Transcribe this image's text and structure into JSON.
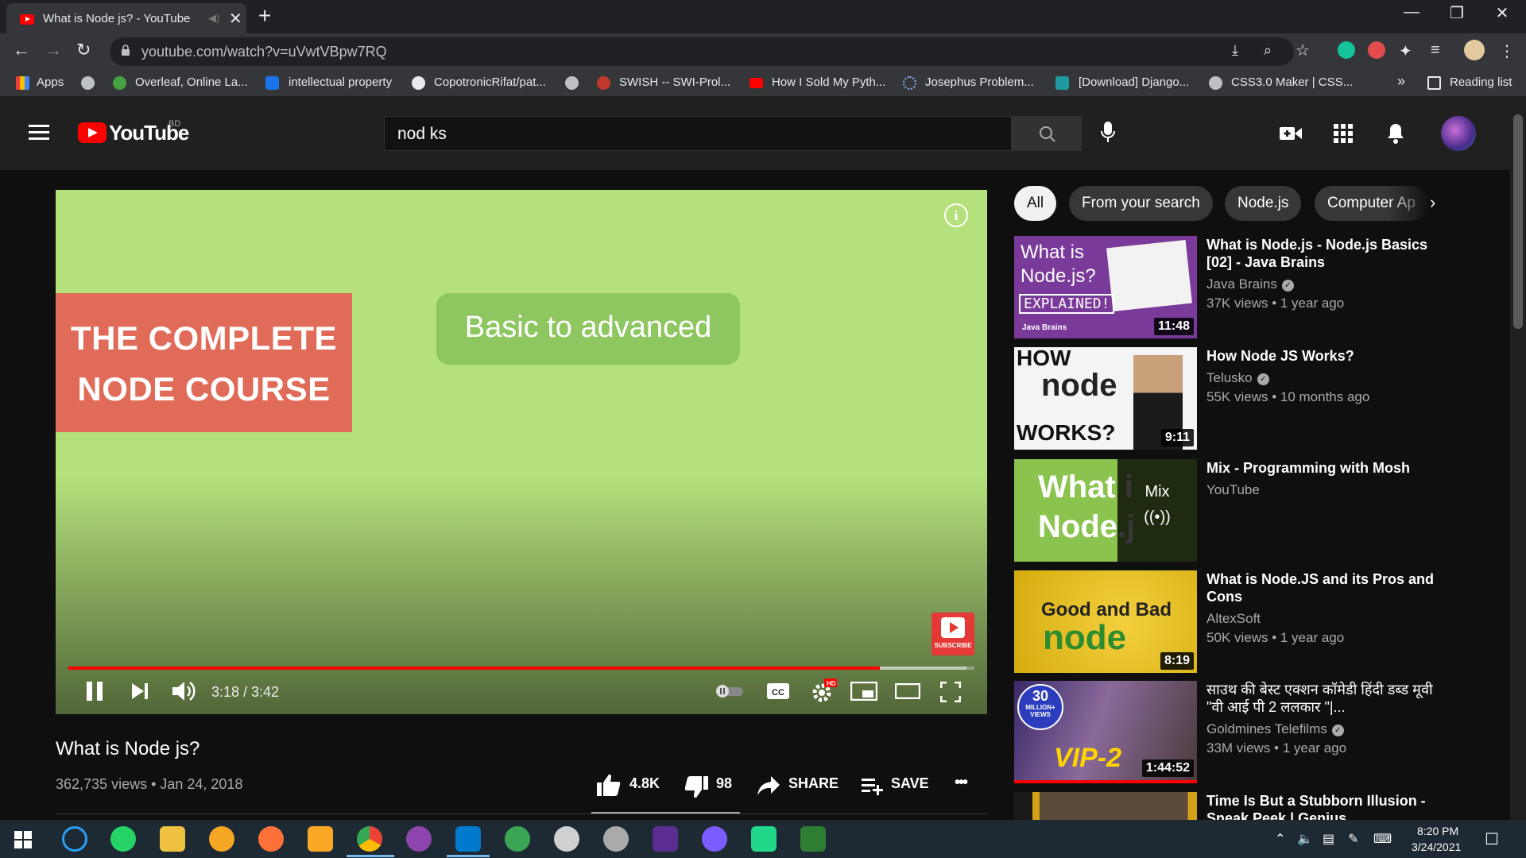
{
  "browser": {
    "tab_title": "What is Node js? - YouTube",
    "url": "youtube.com/watch?v=uVwtVBpw7RQ",
    "bookmarks": [
      "Apps",
      "Overleaf, Online La...",
      "intellectual property",
      "CopotronicRifat/pat...",
      "SWISH -- SWI-Prol...",
      "How I Sold My Pyth...",
      "Josephus Problem...",
      "[Download] Django...",
      "CSS3.0 Maker | CSS...",
      "»",
      "Reading list"
    ]
  },
  "youtube": {
    "logo_text": "YouTube",
    "country_code": "BD",
    "search_query": "nod ks"
  },
  "player": {
    "slide_title_line1": "THE COMPLETE",
    "slide_title_line2": "NODE COURSE",
    "slide_subtitle": "Basic to advanced",
    "subscribe_badge": "SUBSCRIBE",
    "time_display": "3:18 / 3:42",
    "progress_fraction": 0.8954,
    "buffer_fraction": 0.9916,
    "hd_badge": "HD"
  },
  "video": {
    "title": "What is Node js?",
    "views_date": "362,735 views • Jan 24, 2018",
    "likes": "4.8K",
    "dislikes": "98",
    "share_label": "SHARE",
    "save_label": "SAVE",
    "more_label": "•••"
  },
  "chips": [
    "All",
    "From your search",
    "Node.js",
    "Computer Ap"
  ],
  "recommendations": [
    {
      "title": "What is Node.js - Node.js Basics [02] - Java Brains",
      "channel": "Java Brains",
      "verified": true,
      "meta": "37K views • 1 year ago",
      "duration": "11:48",
      "thumb_text": [
        "What is",
        "Node.js?",
        "EXPLAINED!",
        "Java Brains"
      ]
    },
    {
      "title": "How Node JS Works?",
      "channel": "Telusko",
      "verified": true,
      "meta": "55K views • 10 months ago",
      "duration": "9:11",
      "thumb_text": [
        "HOW",
        "node",
        "WORKS?"
      ]
    },
    {
      "title": "Mix - Programming with Mosh",
      "channel": "YouTube",
      "verified": false,
      "meta": "",
      "duration": "",
      "thumb_text": [
        "What i",
        "Node.j",
        "Mix"
      ]
    },
    {
      "title": "What is Node.JS and its Pros and Cons",
      "channel": "AltexSoft",
      "verified": false,
      "meta": "50K views • 1 year ago",
      "duration": "8:19",
      "thumb_text": [
        "Good and Bad",
        "node"
      ]
    },
    {
      "title": "साउथ की बेस्ट एक्शन कॉमेडी हिंदी डब्ड मूवी \"वी आई पी 2 ललकार \"|...",
      "channel": "Goldmines Telefilms",
      "verified": true,
      "meta": "33M views • 1 year ago",
      "duration": "1:44:52",
      "thumb_text": [
        "30",
        "MILLION+",
        "VIEWS",
        "VIP-2"
      ]
    },
    {
      "title": "Time Is But a Stubborn Illusion - Sneak Peek | Genius",
      "channel": "",
      "verified": false,
      "meta": "",
      "duration": "",
      "thumb_text": []
    }
  ],
  "taskbar": {
    "time": "8:20 PM",
    "date": "3/24/2021"
  },
  "colors": {
    "yt_red": "#ff0000",
    "player_bg": "#b4e17b",
    "course_card": "#e06b59",
    "page_bg": "#0f0f0f"
  }
}
